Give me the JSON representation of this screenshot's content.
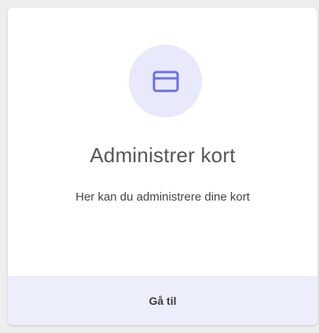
{
  "card": {
    "icon": "credit-card-icon",
    "title": "Administrer kort",
    "description": "Her kan du administrere dine kort",
    "action_label": "Gå til"
  },
  "colors": {
    "accent": "#6b6fe4",
    "icon_background": "#e8e9fb",
    "footer_background": "#eceefb"
  }
}
